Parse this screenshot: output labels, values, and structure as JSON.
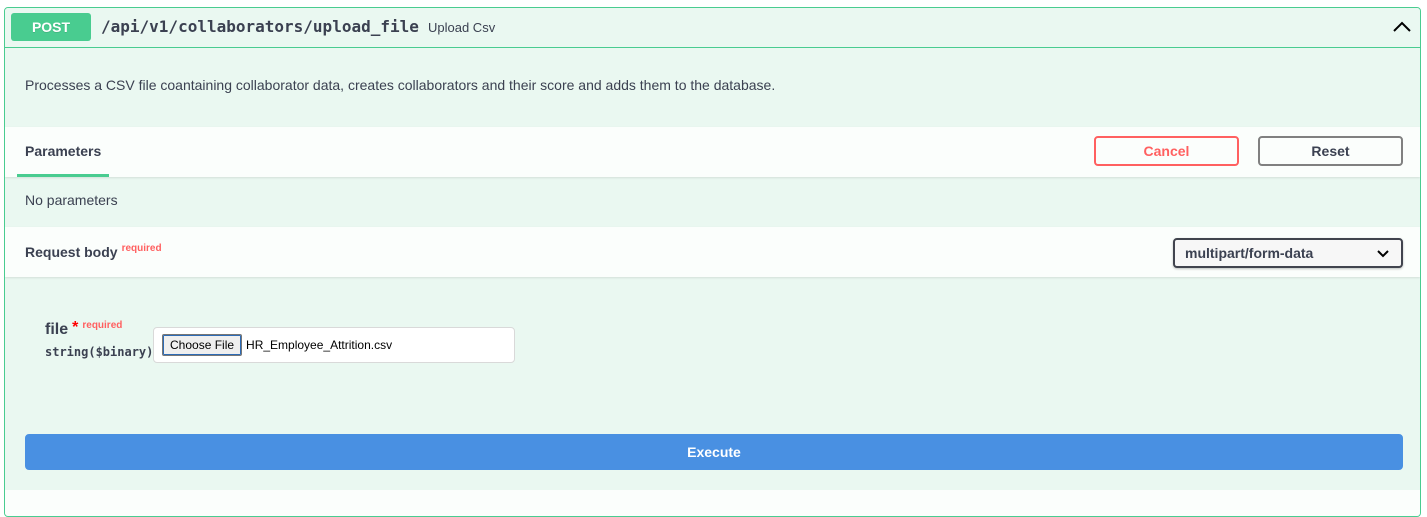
{
  "summary": {
    "method": "POST",
    "path": "/api/v1/collaborators/upload_file",
    "description": "Upload Csv"
  },
  "description": "Processes a CSV file coantaining collaborator data, creates collaborators and their score and adds them to the database.",
  "parameters": {
    "tab_label": "Parameters",
    "cancel_label": "Cancel",
    "reset_label": "Reset",
    "empty_text": "No parameters"
  },
  "request_body": {
    "title": "Request body",
    "required_label": "required",
    "content_type": "multipart/form-data"
  },
  "file_param": {
    "name": "file",
    "star": "*",
    "required_label": "required",
    "type": "string($binary)",
    "choose_label": "Choose File",
    "file_name": "HR_Employee_Attrition.csv"
  },
  "execute_label": "Execute",
  "colors": {
    "post_green": "#49cc90",
    "background": "#eaf8f1",
    "cancel_red": "#ff6060",
    "execute_blue": "#4990e2"
  },
  "icons": {
    "collapse": "chevron-up-icon",
    "select": "chevron-down-icon"
  }
}
